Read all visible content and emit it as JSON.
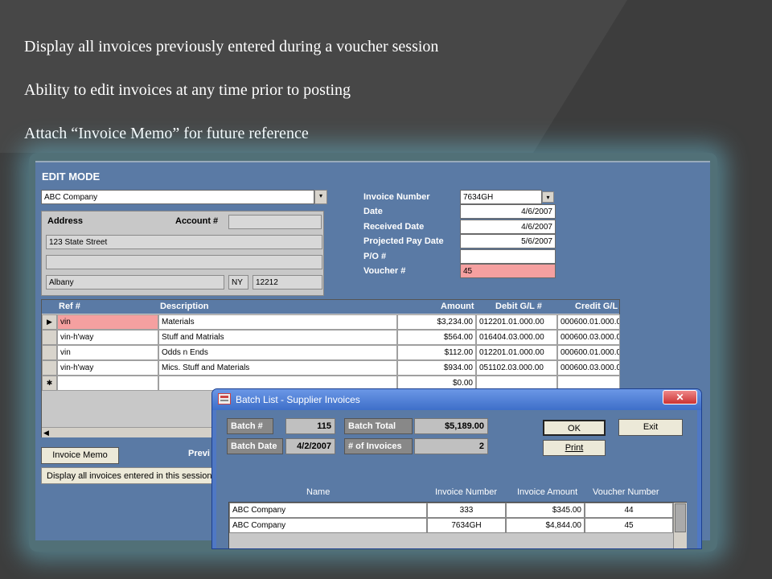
{
  "slide": {
    "bullets": [
      "Display all invoices previously entered during a voucher session",
      "Ability to edit invoices at any time prior to posting",
      "Attach “Invoice Memo” for future reference"
    ]
  },
  "form": {
    "mode_title": "EDIT MODE",
    "vendor": "ABC Company",
    "address_label": "Address",
    "account_label": "Account #",
    "account_value": "",
    "street": "123 State Street",
    "street2": "",
    "city": "Albany",
    "state": "NY",
    "zip": "12212",
    "fields": [
      {
        "label": "Invoice Number",
        "value": "7634GH"
      },
      {
        "label": "Date",
        "value": "4/6/2007"
      },
      {
        "label": "Received Date",
        "value": "4/6/2007"
      },
      {
        "label": "Projected Pay Date",
        "value": "5/6/2007"
      },
      {
        "label": "P/O #",
        "value": ""
      },
      {
        "label": "Voucher #",
        "value": "45"
      }
    ],
    "voucher_color": "#f5a0a0"
  },
  "grid": {
    "headers": [
      "Ref #",
      "Description",
      "Amount",
      "Debit G/L #",
      "Credit G/L"
    ],
    "rows": [
      {
        "ref": "vin",
        "desc": "Materials",
        "amount": "$3,234.00",
        "debit": "012201.01.000.00",
        "credit": "000600.01.000.0",
        "marker": "▶"
      },
      {
        "ref": "vin-h'way",
        "desc": "Stuff and Matrials",
        "amount": "$564.00",
        "debit": "016404.03.000.00",
        "credit": "000600.03.000.0",
        "marker": ""
      },
      {
        "ref": "vin",
        "desc": "Odds n Ends",
        "amount": "$112.00",
        "debit": "012201.01.000.00",
        "credit": "000600.01.000.0",
        "marker": ""
      },
      {
        "ref": "vin-h'way",
        "desc": "Mics. Stuff and Materials",
        "amount": "$934.00",
        "debit": "051102.03.000.00",
        "credit": "000600.03.000.0",
        "marker": ""
      },
      {
        "ref": "",
        "desc": "",
        "amount": "$0.00",
        "debit": "",
        "credit": "",
        "marker": "✱"
      }
    ],
    "selected_color": "#f5a0a0"
  },
  "bottom": {
    "memo_button": "Invoice Memo",
    "prev_label": "Previ",
    "status_text": "Display all invoices entered in this session"
  },
  "dialog": {
    "title": "Batch List - Supplier Invoices",
    "close_label": "✕",
    "batch_no_label": "Batch #",
    "batch_no": "115",
    "batch_total_label": "Batch Total",
    "batch_total": "$5,189.00",
    "batch_date_label": "Batch Date",
    "batch_date": "4/2/2007",
    "num_invoices_label": "# of Invoices",
    "num_invoices": "2",
    "ok_label": "OK",
    "exit_label": "Exit",
    "print_label": "Print",
    "columns": [
      "Name",
      "Invoice Number",
      "Invoice Amount",
      "Voucher Number"
    ],
    "rows": [
      {
        "name": "ABC Company",
        "inv": "333",
        "amt": "$345.00",
        "voucher": "44"
      },
      {
        "name": "ABC Company",
        "inv": "7634GH",
        "amt": "$4,844.00",
        "voucher": "45"
      }
    ]
  }
}
